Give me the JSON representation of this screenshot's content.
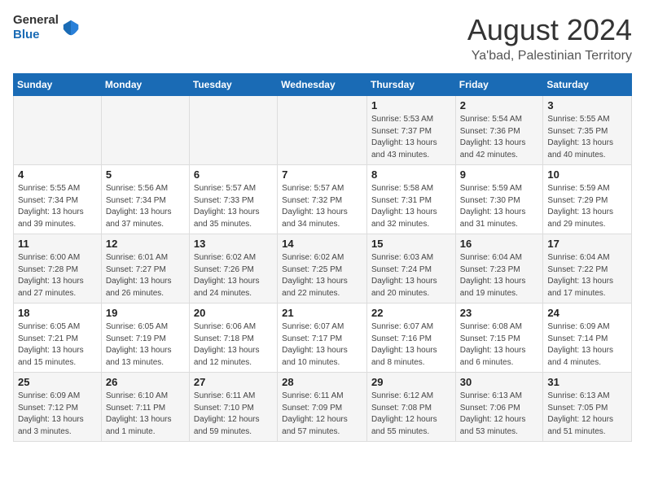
{
  "header": {
    "logo_general": "General",
    "logo_blue": "Blue",
    "title": "August 2024",
    "subtitle": "Ya'bad, Palestinian Territory"
  },
  "weekdays": [
    "Sunday",
    "Monday",
    "Tuesday",
    "Wednesday",
    "Thursday",
    "Friday",
    "Saturday"
  ],
  "weeks": [
    [
      {
        "day": "",
        "info": ""
      },
      {
        "day": "",
        "info": ""
      },
      {
        "day": "",
        "info": ""
      },
      {
        "day": "",
        "info": ""
      },
      {
        "day": "1",
        "info": "Sunrise: 5:53 AM\nSunset: 7:37 PM\nDaylight: 13 hours and 43 minutes."
      },
      {
        "day": "2",
        "info": "Sunrise: 5:54 AM\nSunset: 7:36 PM\nDaylight: 13 hours and 42 minutes."
      },
      {
        "day": "3",
        "info": "Sunrise: 5:55 AM\nSunset: 7:35 PM\nDaylight: 13 hours and 40 minutes."
      }
    ],
    [
      {
        "day": "4",
        "info": "Sunrise: 5:55 AM\nSunset: 7:34 PM\nDaylight: 13 hours and 39 minutes."
      },
      {
        "day": "5",
        "info": "Sunrise: 5:56 AM\nSunset: 7:34 PM\nDaylight: 13 hours and 37 minutes."
      },
      {
        "day": "6",
        "info": "Sunrise: 5:57 AM\nSunset: 7:33 PM\nDaylight: 13 hours and 35 minutes."
      },
      {
        "day": "7",
        "info": "Sunrise: 5:57 AM\nSunset: 7:32 PM\nDaylight: 13 hours and 34 minutes."
      },
      {
        "day": "8",
        "info": "Sunrise: 5:58 AM\nSunset: 7:31 PM\nDaylight: 13 hours and 32 minutes."
      },
      {
        "day": "9",
        "info": "Sunrise: 5:59 AM\nSunset: 7:30 PM\nDaylight: 13 hours and 31 minutes."
      },
      {
        "day": "10",
        "info": "Sunrise: 5:59 AM\nSunset: 7:29 PM\nDaylight: 13 hours and 29 minutes."
      }
    ],
    [
      {
        "day": "11",
        "info": "Sunrise: 6:00 AM\nSunset: 7:28 PM\nDaylight: 13 hours and 27 minutes."
      },
      {
        "day": "12",
        "info": "Sunrise: 6:01 AM\nSunset: 7:27 PM\nDaylight: 13 hours and 26 minutes."
      },
      {
        "day": "13",
        "info": "Sunrise: 6:02 AM\nSunset: 7:26 PM\nDaylight: 13 hours and 24 minutes."
      },
      {
        "day": "14",
        "info": "Sunrise: 6:02 AM\nSunset: 7:25 PM\nDaylight: 13 hours and 22 minutes."
      },
      {
        "day": "15",
        "info": "Sunrise: 6:03 AM\nSunset: 7:24 PM\nDaylight: 13 hours and 20 minutes."
      },
      {
        "day": "16",
        "info": "Sunrise: 6:04 AM\nSunset: 7:23 PM\nDaylight: 13 hours and 19 minutes."
      },
      {
        "day": "17",
        "info": "Sunrise: 6:04 AM\nSunset: 7:22 PM\nDaylight: 13 hours and 17 minutes."
      }
    ],
    [
      {
        "day": "18",
        "info": "Sunrise: 6:05 AM\nSunset: 7:21 PM\nDaylight: 13 hours and 15 minutes."
      },
      {
        "day": "19",
        "info": "Sunrise: 6:05 AM\nSunset: 7:19 PM\nDaylight: 13 hours and 13 minutes."
      },
      {
        "day": "20",
        "info": "Sunrise: 6:06 AM\nSunset: 7:18 PM\nDaylight: 13 hours and 12 minutes."
      },
      {
        "day": "21",
        "info": "Sunrise: 6:07 AM\nSunset: 7:17 PM\nDaylight: 13 hours and 10 minutes."
      },
      {
        "day": "22",
        "info": "Sunrise: 6:07 AM\nSunset: 7:16 PM\nDaylight: 13 hours and 8 minutes."
      },
      {
        "day": "23",
        "info": "Sunrise: 6:08 AM\nSunset: 7:15 PM\nDaylight: 13 hours and 6 minutes."
      },
      {
        "day": "24",
        "info": "Sunrise: 6:09 AM\nSunset: 7:14 PM\nDaylight: 13 hours and 4 minutes."
      }
    ],
    [
      {
        "day": "25",
        "info": "Sunrise: 6:09 AM\nSunset: 7:12 PM\nDaylight: 13 hours and 3 minutes."
      },
      {
        "day": "26",
        "info": "Sunrise: 6:10 AM\nSunset: 7:11 PM\nDaylight: 13 hours and 1 minute."
      },
      {
        "day": "27",
        "info": "Sunrise: 6:11 AM\nSunset: 7:10 PM\nDaylight: 12 hours and 59 minutes."
      },
      {
        "day": "28",
        "info": "Sunrise: 6:11 AM\nSunset: 7:09 PM\nDaylight: 12 hours and 57 minutes."
      },
      {
        "day": "29",
        "info": "Sunrise: 6:12 AM\nSunset: 7:08 PM\nDaylight: 12 hours and 55 minutes."
      },
      {
        "day": "30",
        "info": "Sunrise: 6:13 AM\nSunset: 7:06 PM\nDaylight: 12 hours and 53 minutes."
      },
      {
        "day": "31",
        "info": "Sunrise: 6:13 AM\nSunset: 7:05 PM\nDaylight: 12 hours and 51 minutes."
      }
    ]
  ]
}
